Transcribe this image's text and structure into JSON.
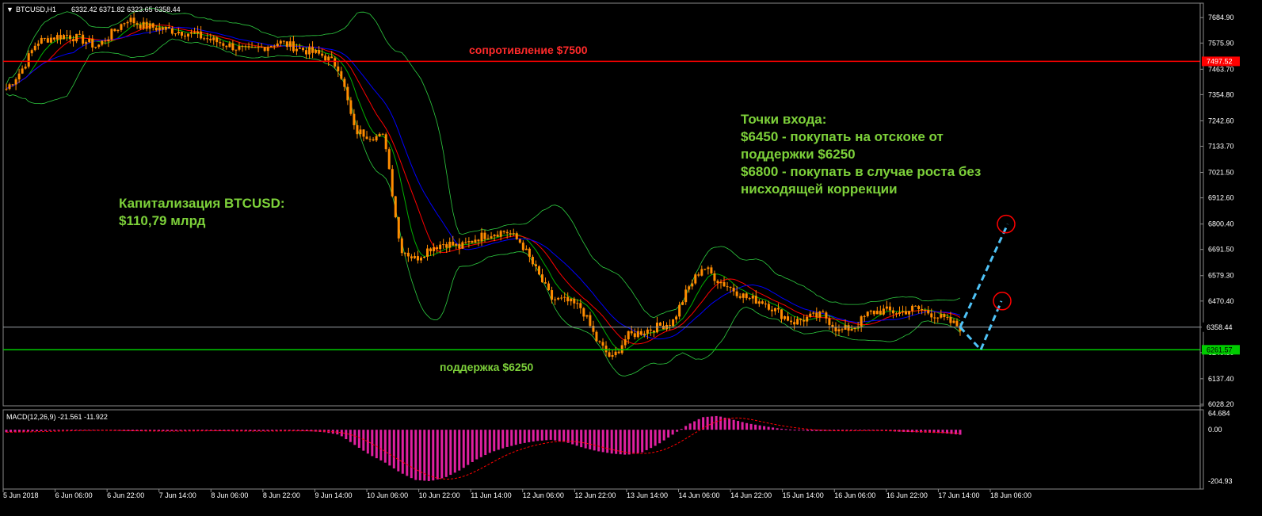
{
  "header": {
    "symbol": "BTCUSD,H1",
    "ohlc": "6332.42 6371.82 6323.65 6358.44"
  },
  "macd_header": {
    "label": "MACD(12,26,9) -21.561 -11.922"
  },
  "annotations": {
    "resistance": "сопротивление $7500",
    "support": "поддержка $6250",
    "cap_title": "Капитализация BTCUSD:",
    "cap_value": "$110,79 млрд",
    "entry_title": "Точки входа:",
    "entry_1a": "$6450 - покупать на отскоке от",
    "entry_1b": "поддержки $6250",
    "entry_2a": "$6800 - покупать в случае роста без",
    "entry_2b": "нисходящей коррекции"
  },
  "colors": {
    "background": "#000000",
    "candle_up": "#ff8c00",
    "candle_down": "#ff8c00",
    "resistance_line": "#ff0000",
    "support_line": "#00cc00",
    "current_line": "#9aa0a6",
    "ma_fast": "#00b000",
    "ma_mid": "#ff0000",
    "ma_slow": "#0000ff",
    "bollinger": "#2ecc40",
    "macd_hist": "#e020a0",
    "macd_signal": "#ff0000",
    "projection": "#4fc3f7",
    "target_circle": "#ff0000",
    "annotation_green": "#7dd13a",
    "annotation_red": "#ff2a2a"
  },
  "chart_data": {
    "type": "candlestick",
    "price_axis_ticks": [
      "7684.90",
      "7575.90",
      "7463.70",
      "7354.80",
      "7242.60",
      "7133.70",
      "7021.50",
      "6912.60",
      "6800.40",
      "6691.50",
      "6579.30",
      "6470.40",
      "6358.44",
      "6249.50",
      "6137.40",
      "6028.20"
    ],
    "price_badges": {
      "resistance": "7497.52",
      "current": "6358.44",
      "support": "6261.57"
    },
    "levels": {
      "resistance": 7497.52,
      "current": 6358.44,
      "support": 6261.57
    },
    "ylim": [
      6028.2,
      7740
    ],
    "macd_axis_ticks": [
      "64.684",
      "0.00",
      "-204.93"
    ],
    "macd_ylim": [
      -230,
      70
    ],
    "x_ticks": [
      "5 Jun 2018",
      "6 Jun 06:00",
      "6 Jun 22:00",
      "7 Jun 14:00",
      "8 Jun 06:00",
      "8 Jun 22:00",
      "9 Jun 14:00",
      "10 Jun 06:00",
      "10 Jun 22:00",
      "11 Jun 14:00",
      "12 Jun 06:00",
      "12 Jun 22:00",
      "13 Jun 14:00",
      "14 Jun 06:00",
      "14 Jun 22:00",
      "15 Jun 14:00",
      "16 Jun 06:00",
      "16 Jun 22:00",
      "17 Jun 14:00",
      "18 Jun 06:00"
    ],
    "close_path": [
      7380,
      7460,
      7580,
      7600,
      7610,
      7590,
      7560,
      7620,
      7680,
      7650,
      7640,
      7630,
      7620,
      7600,
      7580,
      7560,
      7540,
      7560,
      7580,
      7560,
      7540,
      7520,
      7470,
      7200,
      7180,
      7170,
      6700,
      6650,
      6700,
      6720,
      6700,
      6740,
      6760,
      6770,
      6720,
      6600,
      6480,
      6470,
      6440,
      6300,
      6220,
      6320,
      6340,
      6360,
      6380,
      6520,
      6620,
      6560,
      6520,
      6480,
      6470,
      6420,
      6380,
      6400,
      6410,
      6340,
      6360,
      6420,
      6430,
      6420,
      6440,
      6420,
      6390,
      6358
    ],
    "macd_hist": [
      -10,
      -8,
      -6,
      -4,
      -3,
      -2,
      -3,
      -4,
      -5,
      -6,
      -6,
      -5,
      -4,
      -4,
      -5,
      -6,
      -6,
      -5,
      -4,
      -4,
      -6,
      -10,
      -20,
      -60,
      -100,
      -130,
      -170,
      -200,
      -205,
      -190,
      -160,
      -120,
      -90,
      -70,
      -55,
      -45,
      -40,
      -50,
      -70,
      -85,
      -95,
      -100,
      -90,
      -60,
      -20,
      20,
      50,
      55,
      40,
      25,
      15,
      5,
      0,
      -5,
      -5,
      -4,
      -3,
      -3,
      -5,
      -8,
      -10,
      -12,
      -14,
      -20
    ],
    "projections": [
      {
        "from": 6358.44,
        "to": 6800.4
      },
      {
        "from": 6358.44,
        "via": 6261.57,
        "to": 6470.4
      }
    ]
  }
}
